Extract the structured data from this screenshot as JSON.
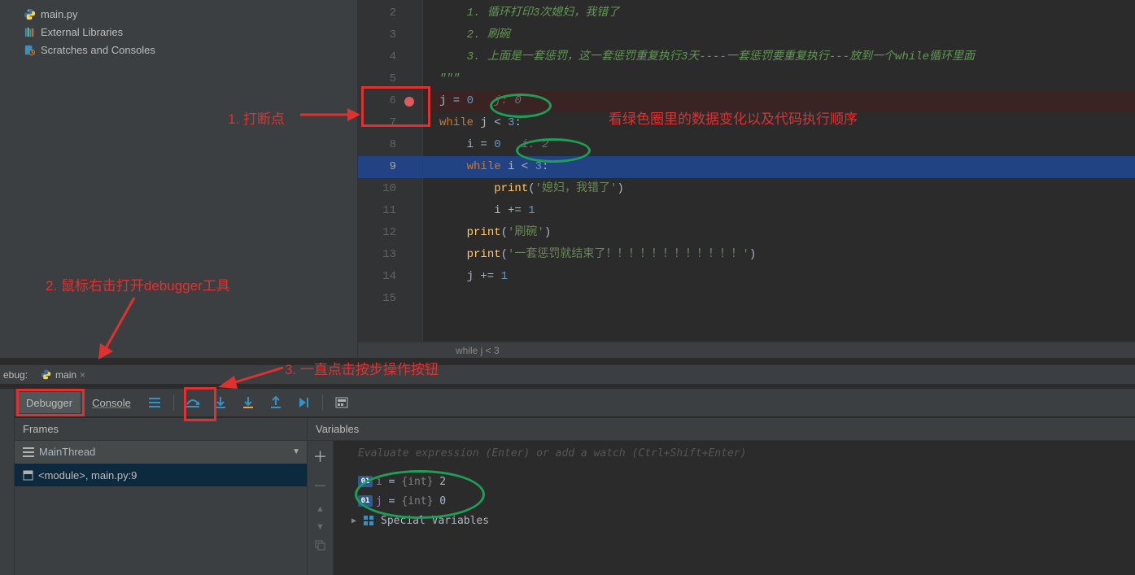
{
  "project": {
    "items": [
      {
        "icon": "python",
        "label": "main.py"
      },
      {
        "icon": "lib",
        "label": "External Libraries"
      },
      {
        "icon": "scratch",
        "label": "Scratches and Consoles"
      }
    ]
  },
  "editor": {
    "lines": [
      {
        "n": 2,
        "indent": 1,
        "cmt_num": "1.",
        "cmt_text": " 循环打印3次媳妇，我错了"
      },
      {
        "n": 3,
        "indent": 1,
        "cmt_num": "2.",
        "cmt_text": " 刷碗"
      },
      {
        "n": 4,
        "indent": 1,
        "cmt_num": "3.",
        "cmt_text": " 上面是一套惩罚，这一套惩罚重复执行3天----一套惩罚要重复执行---放到一个while循环里面"
      },
      {
        "n": 5,
        "indent": 0,
        "triple": "\"\"\""
      },
      {
        "n": 6,
        "indent": 0,
        "bp": true,
        "assign": {
          "name": "j",
          "val": "0"
        },
        "inlay": "j: 0"
      },
      {
        "n": 7,
        "indent": 0,
        "whileline": {
          "var": "j",
          "op": "<",
          "lim": "3"
        }
      },
      {
        "n": 8,
        "indent": 1,
        "assign": {
          "name": "i",
          "val": "0"
        },
        "inlay": "i: 2"
      },
      {
        "n": 9,
        "indent": 1,
        "selected": true,
        "whileline": {
          "var": "i",
          "op": "<",
          "lim": "3"
        }
      },
      {
        "n": 10,
        "indent": 2,
        "printcall": "'媳妇，我错了'"
      },
      {
        "n": 11,
        "indent": 2,
        "aug": {
          "name": "i",
          "val": "1"
        }
      },
      {
        "n": 12,
        "indent": 1,
        "printcall": "'刷碗'"
      },
      {
        "n": 13,
        "indent": 1,
        "printcall": "'一套惩罚就结束了！！！！！！！！！！！！'"
      },
      {
        "n": 14,
        "indent": 1,
        "aug": {
          "name": "j",
          "val": "1"
        }
      },
      {
        "n": 15,
        "indent": 0
      }
    ],
    "breadcrumb": "while j < 3"
  },
  "debug": {
    "header_label": "ebug:",
    "tab_label": "main",
    "tabs": {
      "debugger": "Debugger",
      "console": "Console"
    },
    "frames_title": "Frames",
    "vars_title": "Variables",
    "thread": "MainThread",
    "frame": "<module>, main.py:9",
    "watch_placeholder": "Evaluate expression (Enter) or add a watch (Ctrl+Shift+Enter)",
    "vars": [
      {
        "name": "i",
        "type": "{int}",
        "value": "2"
      },
      {
        "name": "j",
        "type": "{int}",
        "value": "0"
      }
    ],
    "special": "Special Variables"
  },
  "annotations": {
    "a1": "1. 打断点",
    "a2": "2. 鼠标右击打开debugger工具",
    "a3": "3. 一直点击按步操作按钮",
    "a4": "看绿色圈里的数据变化以及代码执行顺序"
  }
}
